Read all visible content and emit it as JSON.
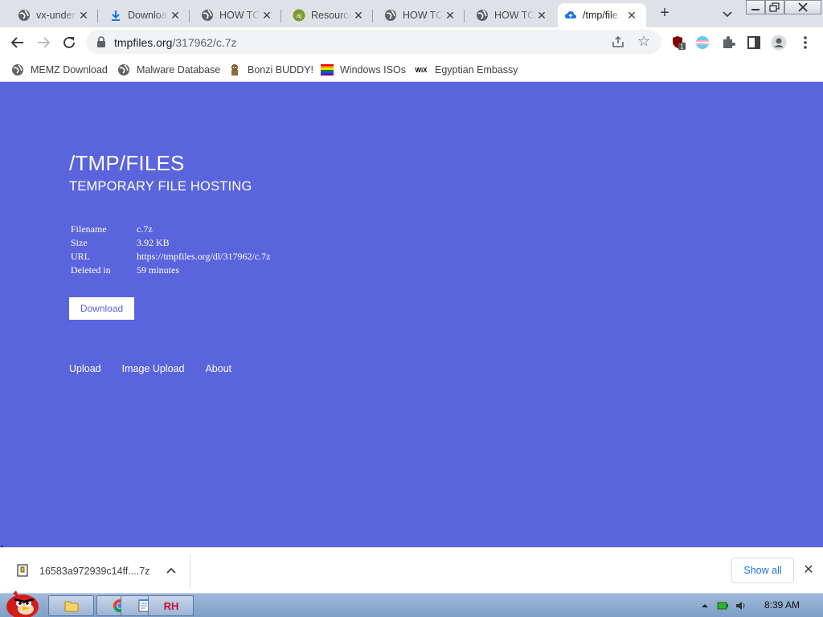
{
  "browser": {
    "tabs": [
      {
        "title": "vx-under",
        "icon": "globe-icon",
        "active": false
      },
      {
        "title": "Download",
        "icon": "download-icon",
        "active": false
      },
      {
        "title": "HOW TO",
        "icon": "globe-icon",
        "active": false
      },
      {
        "title": "Resource",
        "icon": "aj-site-icon",
        "active": false
      },
      {
        "title": "HOW TO",
        "icon": "globe-icon",
        "active": false
      },
      {
        "title": "HOW TO",
        "icon": "globe-icon",
        "active": false
      },
      {
        "title": "/tmp/file",
        "icon": "cloud-upload-icon",
        "active": true
      }
    ],
    "new_tab_label": "+",
    "address": {
      "host": "tmpfiles.org",
      "path": "/317962/c.7z"
    },
    "extension_badge": "1",
    "bookmarks": [
      {
        "label": "MEMZ Download",
        "icon": "globe-icon"
      },
      {
        "label": "Malware Database",
        "icon": "globe-icon"
      },
      {
        "label": "Bonzi BUDDY!",
        "icon": "bonzi-icon"
      },
      {
        "label": "Windows ISOs",
        "icon": "rainbow-flag-icon"
      },
      {
        "label": "Egyptian Embassy",
        "icon": "wix-icon"
      }
    ],
    "wix_text": "WiX"
  },
  "page": {
    "title": "/TMP/FILES",
    "subtitle": "TEMPORARY FILE HOSTING",
    "info": [
      {
        "key": "Filename",
        "value": "c.7z"
      },
      {
        "key": "Size",
        "value": "3.92 KB"
      },
      {
        "key": "URL",
        "value": "https://tmpfiles.org/dl/317962/c.7z"
      },
      {
        "key": "Deleted in",
        "value": "59 minutes"
      }
    ],
    "download_label": "Download",
    "links": [
      "Upload",
      "Image Upload",
      "About"
    ],
    "background_color": "#5a64dc"
  },
  "download_shelf": {
    "filename": "16583a972939c14ff....7z",
    "show_all_label": "Show all"
  },
  "taskbar": {
    "time": "8:39 AM",
    "pinned": [
      "folder-icon",
      "chrome-icon",
      "notepad-icon",
      "rh-icon"
    ]
  }
}
